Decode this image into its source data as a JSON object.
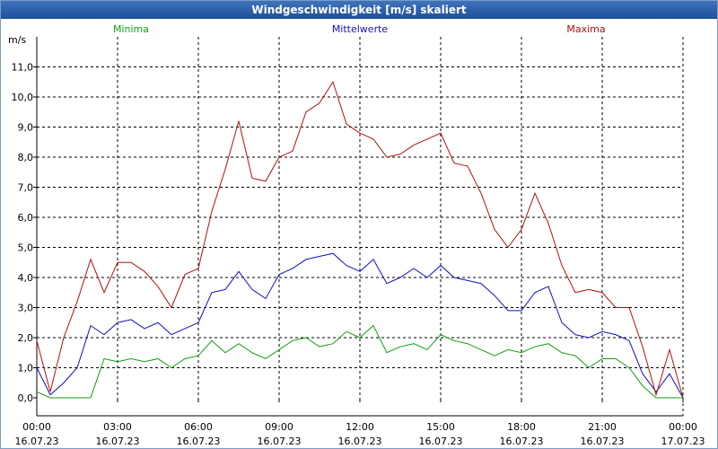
{
  "window": {
    "title": "Windgeschwindigkeit [m/s] skaliert"
  },
  "colors": {
    "min": "#10a010",
    "mean": "#1010c0",
    "max": "#b01010",
    "grid": "#000000",
    "title_bg": "#2a5fab"
  },
  "chart_data": {
    "type": "line",
    "title": "Windgeschwindigkeit [m/s] skaliert",
    "ylabel": "m/s",
    "ylim": [
      0,
      12
    ],
    "yticks": [
      "0,0",
      "1,0",
      "2,0",
      "3,0",
      "4,0",
      "5,0",
      "6,0",
      "7,0",
      "8,0",
      "9,0",
      "10,0",
      "11,0"
    ],
    "xticks": [
      {
        "time": "00:00",
        "date": "16.07.23"
      },
      {
        "time": "03:00",
        "date": "16.07.23"
      },
      {
        "time": "06:00",
        "date": "16.07.23"
      },
      {
        "time": "09:00",
        "date": "16.07.23"
      },
      {
        "time": "12:00",
        "date": "16.07.23"
      },
      {
        "time": "15:00",
        "date": "16.07.23"
      },
      {
        "time": "18:00",
        "date": "16.07.23"
      },
      {
        "time": "21:00",
        "date": "16.07.23"
      },
      {
        "time": "00:00",
        "date": "17.07.23"
      }
    ],
    "grid": true,
    "x_hours": [
      0,
      0.5,
      1,
      1.5,
      2,
      2.5,
      3,
      3.5,
      4,
      4.5,
      5,
      5.5,
      6,
      6.5,
      7,
      7.5,
      8,
      8.5,
      9,
      9.5,
      10,
      10.5,
      11,
      11.5,
      12,
      12.5,
      13,
      13.5,
      14,
      14.5,
      15,
      15.5,
      16,
      16.5,
      17,
      17.5,
      18,
      18.5,
      19,
      19.5,
      20,
      20.5,
      21,
      21.5,
      22,
      22.5,
      23,
      23.5,
      24
    ],
    "series": [
      {
        "name": "Minima",
        "color": "#10a010",
        "values": [
          0.2,
          0.0,
          0.0,
          0.0,
          0.0,
          1.3,
          1.2,
          1.3,
          1.2,
          1.3,
          1.0,
          1.3,
          1.4,
          1.9,
          1.5,
          1.8,
          1.5,
          1.3,
          1.6,
          1.9,
          2.0,
          1.7,
          1.8,
          2.2,
          2.0,
          2.4,
          1.5,
          1.7,
          1.8,
          1.6,
          2.1,
          1.9,
          1.8,
          1.6,
          1.4,
          1.6,
          1.5,
          1.7,
          1.8,
          1.5,
          1.4,
          1.0,
          1.3,
          1.3,
          1.0,
          0.4,
          0.0,
          0.0,
          0.0
        ]
      },
      {
        "name": "Mittelwerte",
        "color": "#1010c0",
        "values": [
          1.0,
          0.1,
          0.5,
          1.0,
          2.4,
          2.1,
          2.5,
          2.6,
          2.3,
          2.5,
          2.1,
          2.3,
          2.5,
          3.5,
          3.6,
          4.2,
          3.6,
          3.3,
          4.1,
          4.3,
          4.6,
          4.7,
          4.8,
          4.4,
          4.2,
          4.6,
          3.8,
          4.0,
          4.3,
          4.0,
          4.4,
          4.0,
          3.9,
          3.8,
          3.4,
          2.9,
          2.9,
          3.5,
          3.7,
          2.5,
          2.1,
          2.0,
          2.2,
          2.1,
          1.9,
          0.8,
          0.2,
          0.8,
          0.0
        ]
      },
      {
        "name": "Maxima",
        "color": "#b01010",
        "values": [
          1.9,
          0.2,
          2.0,
          3.2,
          4.6,
          3.5,
          4.5,
          4.5,
          4.2,
          3.7,
          3.0,
          4.1,
          4.3,
          6.2,
          7.6,
          9.2,
          7.3,
          7.2,
          8.0,
          8.2,
          9.5,
          9.8,
          10.5,
          9.1,
          8.8,
          8.6,
          8.0,
          8.1,
          8.4,
          8.6,
          8.8,
          7.8,
          7.7,
          6.8,
          5.6,
          5.0,
          5.6,
          6.8,
          5.8,
          4.4,
          3.5,
          3.6,
          3.5,
          3.0,
          3.0,
          1.7,
          0.1,
          1.6,
          0.0
        ]
      }
    ]
  }
}
